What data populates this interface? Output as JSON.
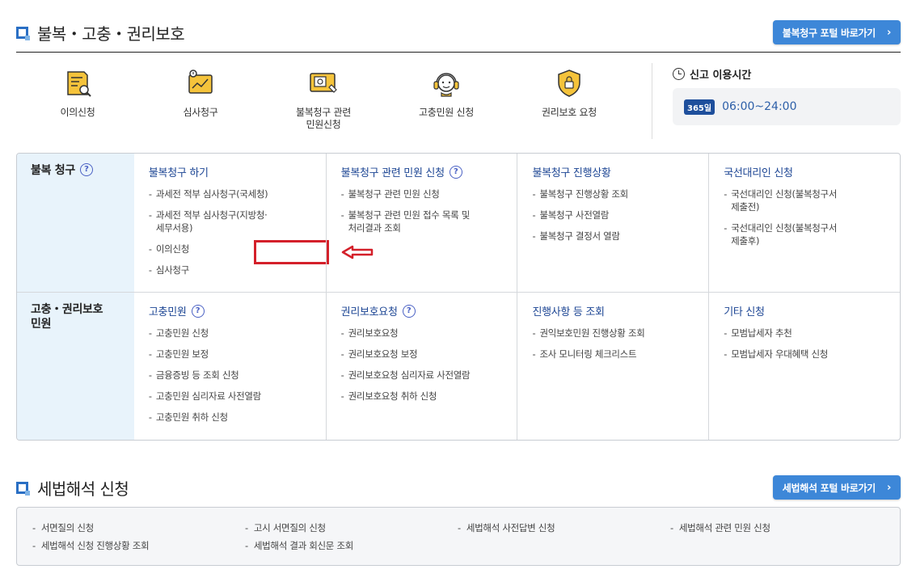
{
  "section1": {
    "title": "불복・고충・권리보호",
    "portal_button": "불복청구 포털 바로가기"
  },
  "quick_menu": [
    {
      "label": "이의신청",
      "icon": "document-search-icon"
    },
    {
      "label": "심사청구",
      "icon": "clipboard-chart-icon"
    },
    {
      "label": "불복청구 관련\n민원신청",
      "icon": "monitor-document-icon"
    },
    {
      "label": "고충민원 신청",
      "icon": "headset-agent-icon"
    },
    {
      "label": "권리보호 요청",
      "icon": "shield-lock-icon"
    }
  ],
  "hours": {
    "title": "신고 이용시간",
    "badge": "365일",
    "time": "06:00~24:00"
  },
  "grid": {
    "row1": {
      "label": "불복 청구",
      "columns": [
        {
          "title": "불복청구 하기",
          "help": false,
          "items": [
            "과세전 적부 심사청구(국세청)",
            "과세전 적부 심사청구(지방청·\n세무서용)",
            "이의신청",
            "심사청구"
          ]
        },
        {
          "title": "불복청구 관련 민원 신청",
          "help": true,
          "items": [
            "불복청구 관련 민원 신청",
            "불복청구 관련 민원 접수 목록 및\n처리결과 조회"
          ]
        },
        {
          "title": "불복청구 진행상황",
          "help": false,
          "items": [
            "불복청구 진행상황 조회",
            "불복청구 사전열람",
            "불복청구 결정서 열람"
          ]
        },
        {
          "title": "국선대리인 신청",
          "help": false,
          "items": [
            "국선대리인 신청(불복청구서\n제출전)",
            "국선대리인 신청(불복청구서\n제출후)"
          ]
        }
      ]
    },
    "row2": {
      "label": "고충・권리보호\n민원",
      "columns": [
        {
          "title": "고충민원",
          "help": true,
          "items": [
            "고충민원 신청",
            "고충민원 보정",
            "금융증빙 등 조회 신청",
            "고충민원 심리자료 사전열람",
            "고충민원 취하 신청"
          ]
        },
        {
          "title": "권리보호요청",
          "help": true,
          "items": [
            "권리보호요청",
            "권리보호요청 보정",
            "권리보호요청 심리자료 사전열람",
            "권리보호요청 취하 신청"
          ]
        },
        {
          "title": "진행사항 등 조회",
          "help": false,
          "items": [
            "권익보호민원 진행상황 조회",
            "조사 모니터링 체크리스트"
          ]
        },
        {
          "title": "기타 신청",
          "help": false,
          "items": [
            "모범납세자 추천",
            "모범납세자 우대혜택 신청"
          ]
        }
      ]
    },
    "help_glyph": "?"
  },
  "section2": {
    "title": "세법해석 신청",
    "portal_button": "세법해석 포털 바로가기",
    "links": [
      "서면질의 신청",
      "고시 서면질의 신청",
      "세법해석 사전답변 신청",
      "세법해석 관련 민원 신청",
      "세법해석 신청 진행상황 조회",
      "세법해석 결과 회신문 조회"
    ]
  },
  "colors": {
    "accent_blue": "#3d87d8",
    "link_blue": "#1d4694",
    "highlight_red": "#d4202a",
    "row_label_bg": "#e8f3fb",
    "icon_yellow": "#f5c33b"
  },
  "chevron_glyph": "›"
}
